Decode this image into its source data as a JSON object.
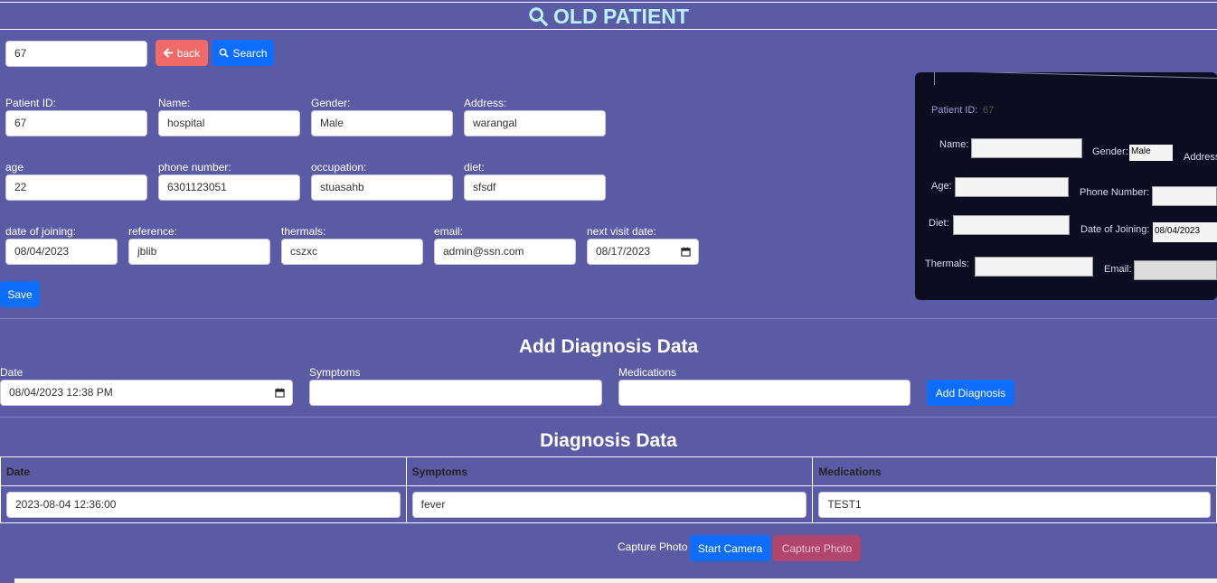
{
  "header": {
    "title": "OLD PATIENT",
    "icon": "search-icon"
  },
  "search": {
    "value": "67",
    "back_label": "back",
    "search_label": "Search"
  },
  "patient": {
    "labels": {
      "patient_id": "Patient ID:",
      "name": "Name:",
      "gender": "Gender:",
      "address": "Address:",
      "age": "age",
      "phone": "phone number:",
      "occupation": "occupation:",
      "diet": "diet:",
      "date_of_joining": "date of joining:",
      "reference": "reference:",
      "thermals": "thermals:",
      "email": "email:",
      "next_visit": "next visit date:"
    },
    "values": {
      "patient_id": "67",
      "name": "hospital",
      "gender": "Male",
      "address": "warangal",
      "age": "22",
      "phone": "6301123051",
      "occupation": "stuasahb",
      "diet": "sfsdf",
      "date_of_joining": "08/04/2023",
      "reference": "jblib",
      "thermals": "cszxc",
      "email": "admin@ssn.com",
      "next_visit": "08/17/2023"
    },
    "save_label": "Save"
  },
  "add_diagnosis": {
    "title": "Add Diagnosis Data",
    "date_label": "Date",
    "symptoms_label": "Symptoms",
    "medications_label": "Medications",
    "date_value": "08/04/2023 12:38 PM",
    "symptoms_value": "",
    "medications_value": "",
    "button_label": "Add Diagnosis"
  },
  "diagnosis_table": {
    "title": "Diagnosis Data",
    "headers": [
      "Date",
      "Symptoms",
      "Medications"
    ],
    "rows": [
      [
        "2023-08-04 12:36:00",
        "fever",
        "TEST1"
      ]
    ]
  },
  "capture": {
    "label": "Capture Photo",
    "start_label": "Start Camera",
    "capture_label": "Capture Photo"
  },
  "photo": {
    "patient_id": "Patient ID:",
    "patient_id_value": "67",
    "name": "Name:",
    "gender": "Gender:",
    "gender_value": "Male",
    "address": "Address",
    "age": "Age:",
    "phone": "Phone Number:",
    "diet": "Diet:",
    "date_of_joining": "Date of Joining:",
    "date_value": "08/04/2023",
    "thermals": "Thermals:",
    "email": "Email:"
  },
  "colors": {
    "background": "#5b5ba5",
    "primary": "#0d6efd",
    "danger": "#f06a6a",
    "title": "#b9f0ff"
  }
}
